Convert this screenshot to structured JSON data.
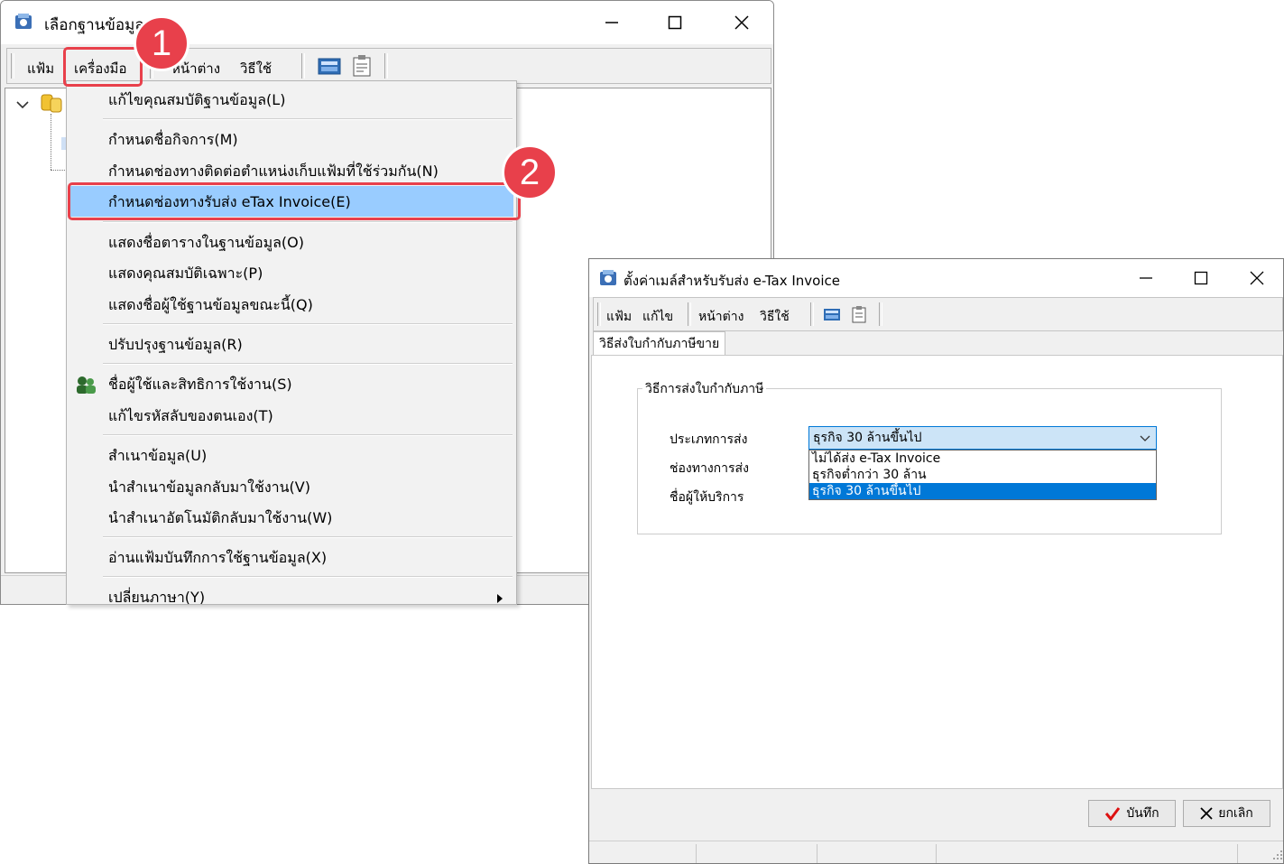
{
  "main_window": {
    "title": "เลือกฐานข้อมูล",
    "menu": {
      "file": "แฟ้ม",
      "tools": "เครื่องมือ",
      "window": "หน้าต่าง",
      "help": "วิธีใช้"
    },
    "icons": [
      "app-icon",
      "database-icon",
      "calculator-icon",
      "clipboard-icon"
    ]
  },
  "tools_menu": {
    "items": [
      "แก้ไขคุณสมบัติฐานข้อมูล(L)",
      "กำหนดชื่อกิจการ(M)",
      "กำหนดช่องทางติดต่อตำแหน่งเก็บแฟ้มที่ใช้ร่วมกัน(N)",
      "กำหนดช่องทางรับส่ง eTax Invoice(E)",
      "แสดงชื่อตารางในฐานข้อมูล(O)",
      "แสดงคุณสมบัติเฉพาะ(P)",
      "แสดงชื่อผู้ใช้ฐานข้อมูลขณะนี้(Q)",
      "ปรับปรุงฐานข้อมูล(R)",
      "ชื่อผู้ใช้และสิทธิการใช้งาน(S)",
      "แก้ไขรหัสลับของตนเอง(T)",
      "สำเนาข้อมูล(U)",
      "นำสำเนาข้อมูลกลับมาใช้งาน(V)",
      "นำสำเนาอัตโนมัติกลับมาใช้งาน(W)",
      "อ่านแฟ้มบันทึกการใช้ฐานข้อมูล(X)",
      "เปลี่ยนภาษา(Y)"
    ],
    "highlighted_index": 3
  },
  "callouts": {
    "step1": "1",
    "step2": "2",
    "color": "#e8404b"
  },
  "dialog": {
    "title": "ตั้งค่าเมล์สำหรับรับส่ง e-Tax Invoice",
    "menu": {
      "file": "แฟ้ม",
      "edit": "แก้ไข",
      "window": "หน้าต่าง",
      "help": "วิธีใช้"
    },
    "tab": "วิธีส่งใบกำกับภาษีขาย",
    "group_title": "วิธีการส่งใบกำกับภาษี",
    "labels": {
      "send_type": "ประเภทการส่ง",
      "channel": "ช่องทางการส่ง",
      "provider": "ชื่อผู้ให้บริการ"
    },
    "send_type_value": "ธุรกิจ 30 ล้านขึ้นไป",
    "send_type_options": [
      "ไม่ได้ส่ง e-Tax Invoice",
      "ธุรกิจต่ำกว่า 30 ล้าน",
      "ธุรกิจ 30 ล้านขึ้นไป"
    ],
    "selected_option_index": 2,
    "buttons": {
      "save": "บันทึก",
      "cancel": "ยกเลิก"
    }
  },
  "colors": {
    "highlight": "#99ccff",
    "selection": "#0078d7",
    "combo_bg": "#cce4f7"
  }
}
